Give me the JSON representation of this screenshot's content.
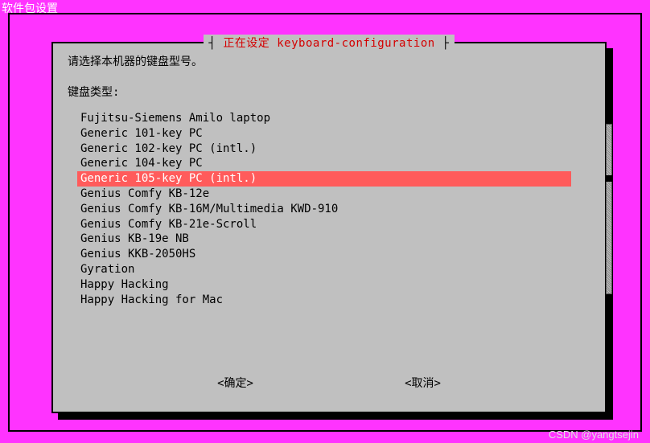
{
  "screen_title": "软件包设置",
  "dialog": {
    "title_prefix": "正在设定 ",
    "title_pkg": "keyboard-configuration",
    "prompt": "请选择本机器的键盘型号。",
    "label": "键盘类型:",
    "selected_index": 4,
    "items": [
      "Fujitsu-Siemens Amilo laptop",
      "Generic 101-key PC",
      "Generic 102-key PC (intl.)",
      "Generic 104-key PC",
      "Generic 105-key PC (intl.)",
      "Genius Comfy KB-12e",
      "Genius Comfy KB-16M/Multimedia KWD-910",
      "Genius Comfy KB-21e-Scroll",
      "Genius KB-19e NB",
      "Genius KKB-2050HS",
      "Gyration",
      "Happy Hacking",
      "Happy Hacking for Mac"
    ],
    "ok_label": "<确定>",
    "cancel_label": "<取消>",
    "scroll": {
      "up_arrow": "↑",
      "down_arrow": "↓"
    }
  },
  "watermark": "CSDN @yangtsejin"
}
